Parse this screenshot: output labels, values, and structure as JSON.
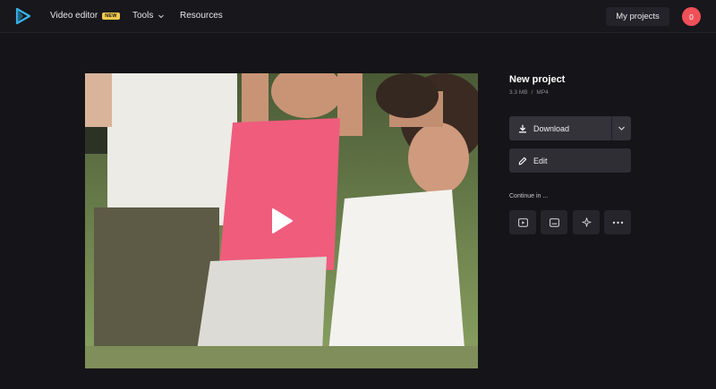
{
  "nav": {
    "video_editor": "Video editor",
    "new_badge": "NEW",
    "tools": "Tools",
    "resources": "Resources",
    "my_projects": "My projects",
    "avatar_initial": "0"
  },
  "project": {
    "title": "New project",
    "size": "3.3 MB",
    "separator": "/",
    "format": "MP4"
  },
  "actions": {
    "download": "Download",
    "edit": "Edit"
  },
  "continue_in": {
    "label": "Continue in ...",
    "tools": [
      "video-player-icon",
      "subtitles-icon",
      "ai-sparkle-icon",
      "more-icon"
    ]
  },
  "colors": {
    "background": "#151418",
    "avatar": "#ef5058",
    "badge": "#f2c94c",
    "logo": "#38b6e8"
  }
}
